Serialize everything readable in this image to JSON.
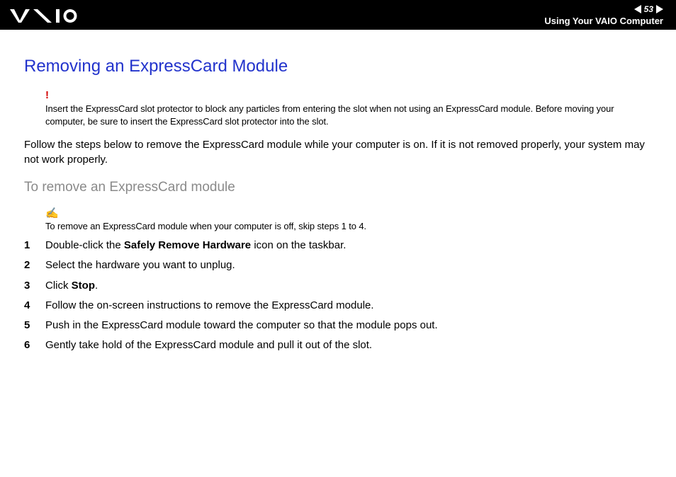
{
  "header": {
    "page_number": "53",
    "breadcrumb": "Using Your VAIO Computer"
  },
  "title": "Removing an ExpressCard Module",
  "caution": {
    "mark": "!",
    "text": "Insert the ExpressCard slot protector to block any particles from entering the slot when not using an ExpressCard module. Before moving your computer, be sure to insert the ExpressCard slot protector into the slot."
  },
  "intro": "Follow the steps below to remove the ExpressCard module while your computer is on. If it is not removed properly, your system may not work properly.",
  "subhead": "To remove an ExpressCard module",
  "note": {
    "mark": "✍",
    "text": "To remove an ExpressCard module when your computer is off, skip steps 1 to 4."
  },
  "steps": {
    "s1a": "Double-click the ",
    "s1b": "Safely Remove Hardware",
    "s1c": " icon on the taskbar.",
    "s2": "Select the hardware you want to unplug.",
    "s3a": "Click ",
    "s3b": "Stop",
    "s3c": ".",
    "s4": "Follow the on-screen instructions to remove the ExpressCard module.",
    "s5": "Push in the ExpressCard module toward the computer so that the module pops out.",
    "s6": "Gently take hold of the ExpressCard module and pull it out of the slot."
  }
}
